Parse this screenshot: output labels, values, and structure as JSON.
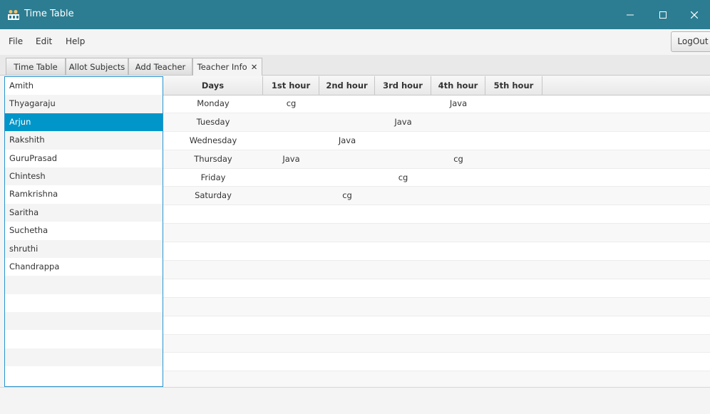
{
  "window": {
    "title": "Time Table",
    "controls": {
      "minimize": "—",
      "maximize": "☐",
      "close": "✕"
    }
  },
  "menu": {
    "items": [
      "File",
      "Edit",
      "Help"
    ],
    "logout_label": "LogOut"
  },
  "tabs": [
    {
      "label": "Time Table"
    },
    {
      "label": "Allot Subjects"
    },
    {
      "label": "Add Teacher"
    },
    {
      "label": "Teacher Info",
      "close": "✕",
      "active": true
    }
  ],
  "teachers": {
    "items": [
      "Amith",
      "Thyagaraju",
      "Arjun",
      "Rakshith",
      "GuruPrasad",
      "Chintesh",
      "Ramkrishna",
      "Saritha",
      "Suchetha",
      "shruthi",
      "Chandrappa"
    ],
    "selected": "Arjun"
  },
  "timetable": {
    "headers": [
      "Days",
      "1st hour",
      "2nd hour",
      "3rd hour",
      "4th hour",
      "5th hour"
    ],
    "rows": [
      [
        "Monday",
        "cg",
        "",
        "",
        "Java",
        ""
      ],
      [
        "Tuesday",
        "",
        "",
        "Java",
        "",
        ""
      ],
      [
        "Wednesday",
        "",
        "Java",
        "",
        "",
        ""
      ],
      [
        "Thursday",
        "Java",
        "",
        "",
        "cg",
        ""
      ],
      [
        "Friday",
        "",
        "",
        "cg",
        "",
        ""
      ],
      [
        "Saturday",
        "",
        "cg",
        "",
        "",
        ""
      ]
    ]
  },
  "colors": {
    "titlebar": "#2c7d92",
    "selection": "#0096c9",
    "list_border": "#2a93cf"
  }
}
